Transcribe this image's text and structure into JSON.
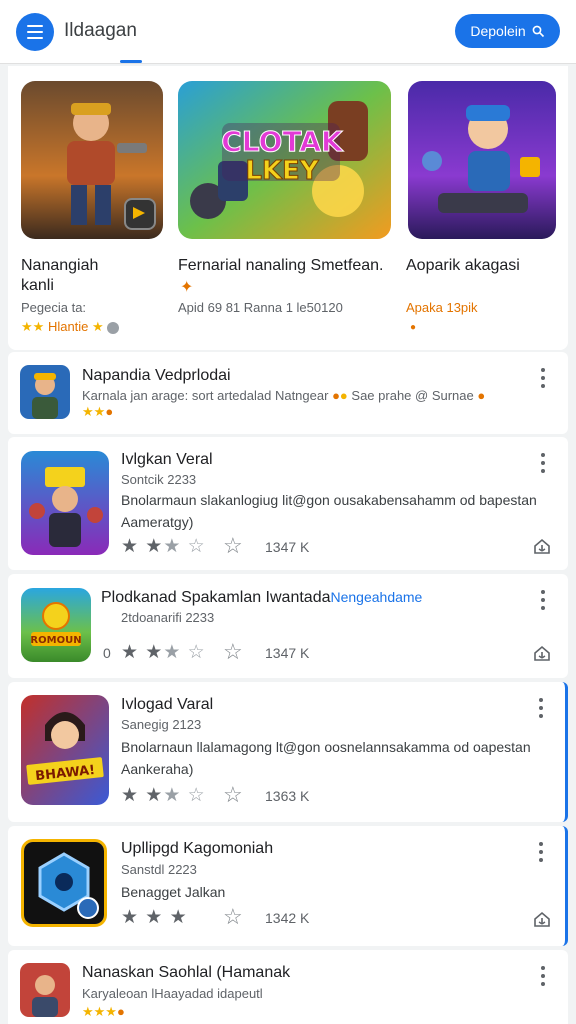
{
  "header": {
    "app_title": "Ildaagan",
    "action_label": "Depolein",
    "action_icon": "search-icon",
    "accent": "#1a73e8"
  },
  "featured": [
    {
      "name": "Nanangiah\nkanli",
      "sub": "Pegecia ta:",
      "rating_text": "Hlantie"
    },
    {
      "name": "Fernarial nanaling Smetfean.",
      "sub": "Apid 69 81 Ranna 1 le50120",
      "banner": "CLOTAK LKEY"
    },
    {
      "name": "Aoparik akagasi",
      "sub": "Apaka 13pik"
    }
  ],
  "list": [
    {
      "title": "Napandia Vedprlodai",
      "sub": "Karnala jan arage: sort artedalad Natngear",
      "extra": "Sae prahe @ Surnae"
    },
    {
      "title": "Ivlgkan Veral",
      "sub": "Sontcik 2233",
      "desc": "Bnolarmaun slakanlogiug lit@gon ousakabensahamm od bapestan Aameratgy)",
      "count": "1347 K"
    },
    {
      "title": "Plodkanad Spakamlan Iwantada",
      "link": "Nengeahdame",
      "sub": "2tdoanarifi 2233",
      "zero": "0",
      "count": "1347 K"
    },
    {
      "title": "Ivlogad Varal",
      "sub": "Sanegig 2123",
      "desc": "Bnolarnaun llalamagong lt@gon oosnelannsakamma od oapestan Aankeraha)",
      "count": "1363 K"
    },
    {
      "title": "Upllipgd Kagomoniah",
      "sub": "Sanstdl 2223",
      "desc": "Benagget Jalkan",
      "count": "1342 K"
    },
    {
      "title": "Nanaskan Saohlal (Hamanak",
      "sub": "Karyaleoan lHaayadad idapeutl"
    }
  ]
}
